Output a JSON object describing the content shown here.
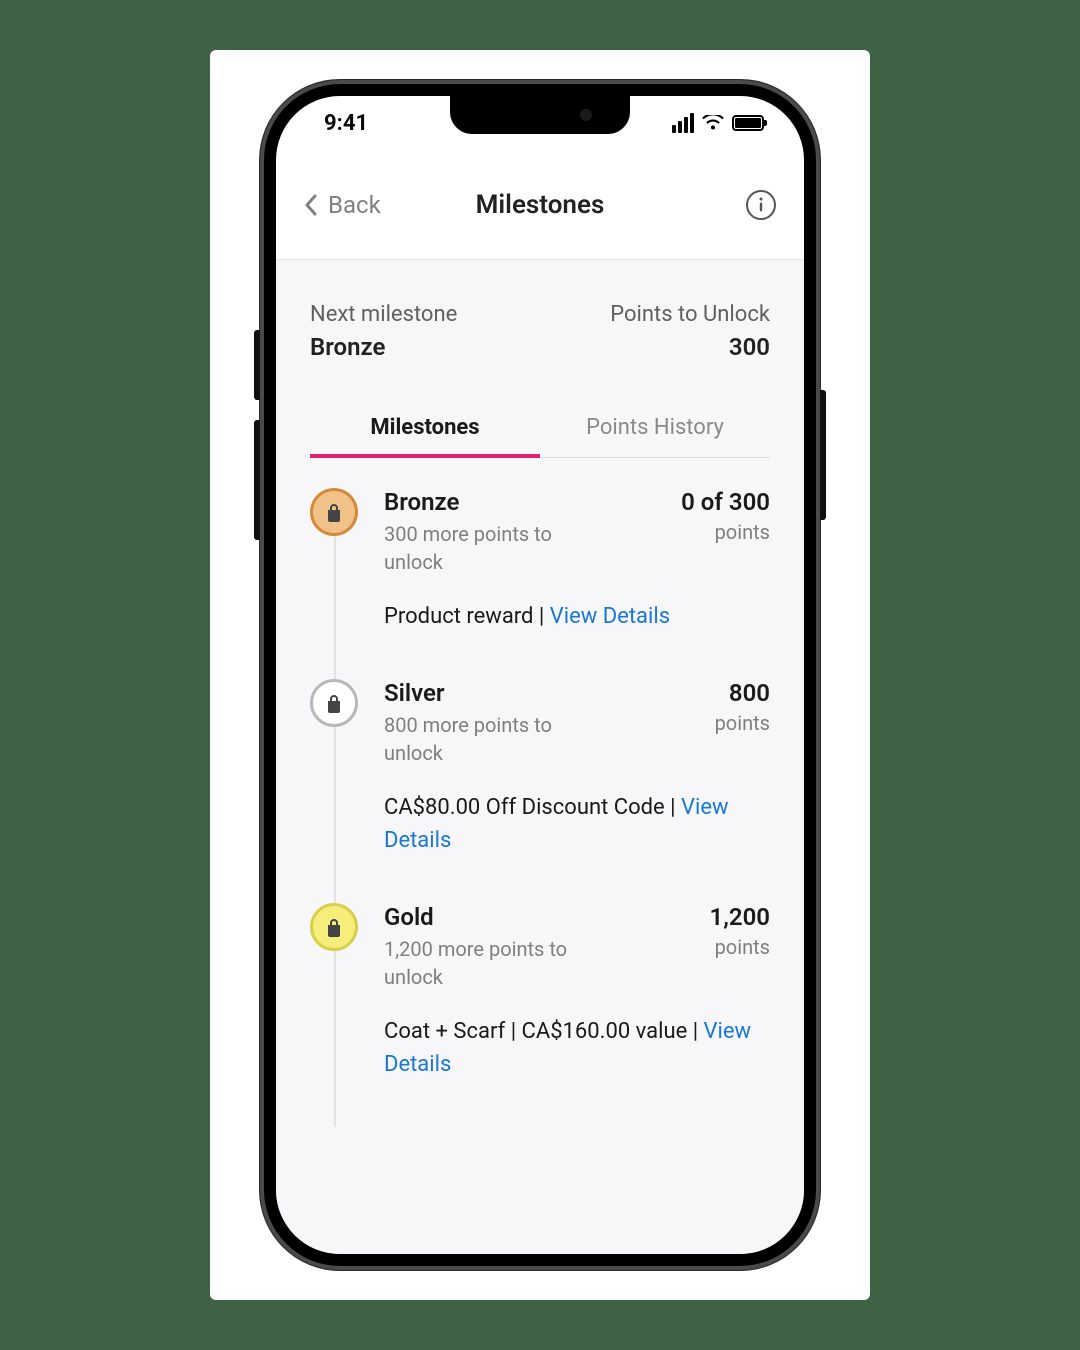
{
  "status": {
    "time": "9:41"
  },
  "nav": {
    "back_label": "Back",
    "title": "Milestones"
  },
  "summary": {
    "left_label": "Next milestone",
    "left_value": "Bronze",
    "right_label": "Points to Unlock",
    "right_value": "300"
  },
  "tabs": {
    "milestones": "Milestones",
    "points_history": "Points History"
  },
  "milestones": [
    {
      "tier": "bronze",
      "title": "Bronze",
      "sub": "300 more points to unlock",
      "points_value": "0 of 300",
      "points_label": "points",
      "reward_text": "Product reward | ",
      "reward_link": "View Details"
    },
    {
      "tier": "silver",
      "title": "Silver",
      "sub": "800 more points to unlock",
      "points_value": "800",
      "points_label": "points",
      "reward_text": "CA$80.00 Off Discount Code | ",
      "reward_link": "View Details"
    },
    {
      "tier": "gold",
      "title": "Gold",
      "sub": "1,200 more points to unlock",
      "points_value": "1,200",
      "points_label": "points",
      "reward_text": "Coat + Scarf | CA$160.00 value | ",
      "reward_link": "View Details"
    }
  ]
}
